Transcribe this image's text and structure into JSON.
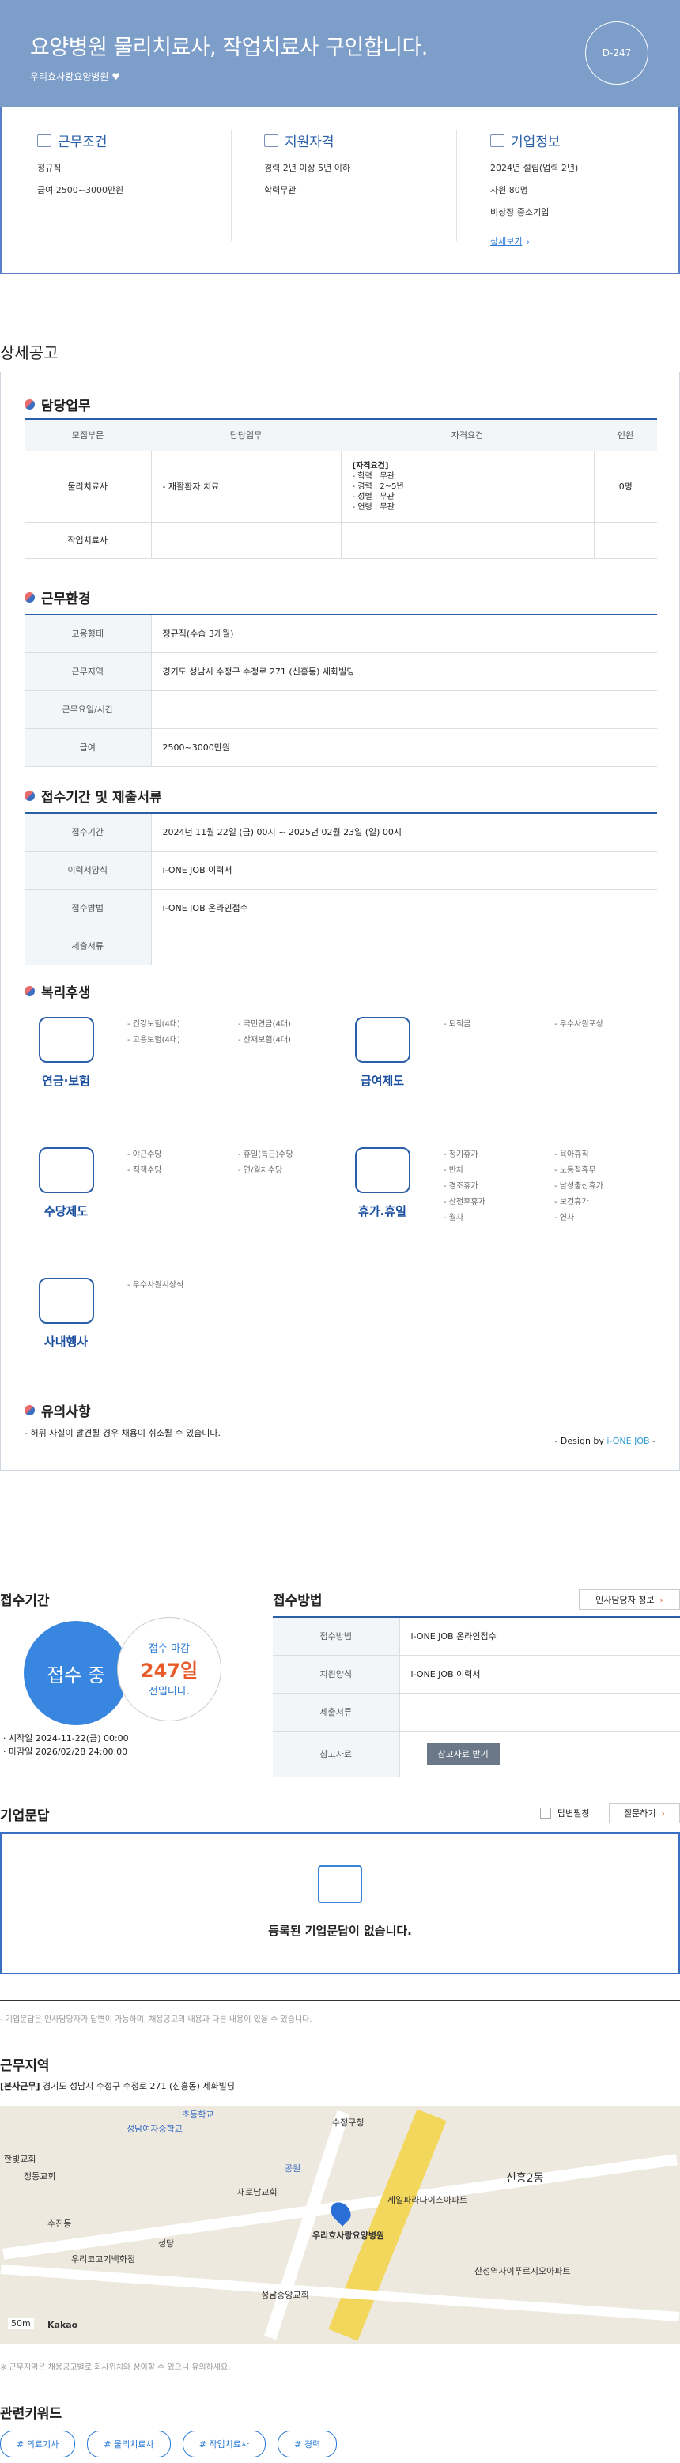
{
  "header": {
    "title": "요양병원 물리치료사, 작업치료사 구인합니다.",
    "company": "우리효사랑요양병원",
    "dday": "D-247"
  },
  "conditions": {
    "title": "근무조건",
    "lines": [
      "정규직",
      "급여 2500~3000만원"
    ]
  },
  "qualification": {
    "title": "지원자격",
    "lines": [
      "경력 2년 이상 5년 이하",
      "학력무관"
    ]
  },
  "company_info": {
    "title": "기업정보",
    "lines": [
      "2024년 설립(업력 2년)",
      "사원 80명",
      "비상장 중소기업"
    ],
    "more": "상세보기"
  },
  "detail_title": "상세공고",
  "duties": {
    "title": "담당업무",
    "headers": [
      "모집부문",
      "담당업무",
      "자격요건",
      "인원"
    ],
    "rows": [
      {
        "part": "물리치료사",
        "task": "- 재활환자 치료",
        "req": [
          "[자격요건]",
          "- 학력 : 무관",
          "- 경력 : 2~5년",
          "- 성별 : 무관",
          "- 연령 : 무관"
        ],
        "count": "0명"
      },
      {
        "part": "작업치료사",
        "task": "",
        "req": [],
        "count": ""
      }
    ]
  },
  "environment": {
    "title": "근무환경",
    "rows": [
      {
        "k": "고용형태",
        "v": "정규직(수습 3개월)"
      },
      {
        "k": "근무지역",
        "v": "경기도 성남시 수정구 수정로 271 (신흥동) 세화빌딩"
      },
      {
        "k": "근무요일/시간",
        "v": ""
      },
      {
        "k": "급여",
        "v": "2500~3000만원"
      }
    ]
  },
  "apply": {
    "title": "접수기간 및 제출서류",
    "rows": [
      {
        "k": "접수기간",
        "v": "2024년 11월 22일 (금) 00시 ~ 2025년 02월 23일 (일) 00시"
      },
      {
        "k": "이력서양식",
        "v": "i-ONE JOB 이력서"
      },
      {
        "k": "접수방법",
        "v": "i-ONE JOB 온라인접수"
      },
      {
        "k": "제출서류",
        "v": ""
      }
    ]
  },
  "welfare": {
    "title": "복리후생",
    "groups": [
      {
        "name": "연금·보험",
        "items": [
          "- 건강보험(4대)",
          "- 고용보험(4대)",
          "- 국민연금(4대)",
          "- 산재보험(4대)"
        ]
      },
      {
        "name": "급여제도",
        "items": [
          "- 퇴직금",
          "- 우수사원포상"
        ]
      },
      {
        "name": "수당제도",
        "items": [
          "- 야근수당",
          "- 직책수당",
          "- 휴일(특근)수당",
          "- 연/월차수당"
        ]
      },
      {
        "name": "휴가.휴일",
        "items": [
          "- 정기휴가",
          "- 반차",
          "- 경조휴가",
          "- 산전후휴가",
          "- 월차",
          "- 육아휴직",
          "- 노동절휴무",
          "- 남성출산휴가",
          "- 보건휴가",
          "- 연차"
        ]
      },
      {
        "name": "사내행사",
        "items": [
          "- 우수사원시상식"
        ]
      }
    ]
  },
  "notice": {
    "title": "유의사항",
    "text": "- 허위 사실이 발견될 경우 채용이 취소될 수 있습니다.",
    "design_prefix": "- Design by ",
    "design_brand": "i-ONE JOB",
    "design_suffix": " -"
  },
  "period": {
    "title": "접수기간",
    "status": "접수 중",
    "deadline_label": "접수 마감",
    "days": "247일",
    "days_suffix": "전입니다.",
    "start": "· 시작일 2024-11-22(금) 00:00",
    "end": "· 마감일 2026/02/28 24:00:00"
  },
  "method": {
    "title": "접수방법",
    "hr_button": "인사담당자 정보",
    "rows": [
      {
        "k": "접수방법",
        "v": "i-ONE JOB 온라인접수"
      },
      {
        "k": "지원양식",
        "v": "i-ONE JOB 이력서"
      },
      {
        "k": "제출서류",
        "v": ""
      },
      {
        "k": "참고자료",
        "v": ""
      }
    ],
    "ref_button": "참고자료 받기"
  },
  "qa": {
    "title": "기업문답",
    "toggle": "답변필칭",
    "ask_button": "질문하기",
    "empty": "등록된 기업문답이 없습니다.",
    "note": "- 기업문답은 인사담당자가 답변이 가능하며, 채용공고의 내용과 다른 내용이 있을 수 있습니다."
  },
  "location": {
    "title": "근무지역",
    "label": "[본사근무]",
    "address": "경기도 성남시 수정구 수정로 271 (신흥동) 세화빌딩",
    "note": "※ 근무지역은 채용공고별로 회사위치와 상이할 수 있으니 유의하세요.",
    "map_labels": [
      "초등학교",
      "수정구청",
      "성남여자중학교",
      "한빛교회",
      "정동교회",
      "공원",
      "새로남교회",
      "성남중앙교회",
      "우리효사랑요양병원",
      "수진동",
      "신흥2동",
      "우리코고기백화점",
      "성당",
      "세일파라다이스아파트",
      "산성역자이푸르지오아파트",
      "50m",
      "Kakao"
    ]
  },
  "keywords": {
    "title": "관련키워드",
    "items": [
      "# 의료기사",
      "# 물리치료사",
      "# 작업치료사",
      "# 경력"
    ]
  }
}
